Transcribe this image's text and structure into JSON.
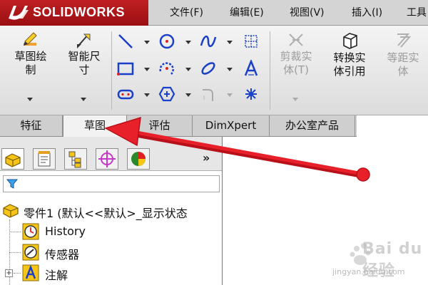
{
  "app": {
    "logo_text": "SOLIDWORKS"
  },
  "menu": [
    "文件(F)",
    "编辑(E)",
    "视图(V)",
    "插入(I)",
    "工具"
  ],
  "toolbar": {
    "sketch_button": [
      "草图绘",
      "制"
    ],
    "smart_dim_button": [
      "智能尺",
      "寸"
    ],
    "trim_button": [
      "剪裁实",
      "体(T)"
    ],
    "convert_button": [
      "转换实",
      "体引用"
    ],
    "offset_button": [
      "等距实",
      "体"
    ]
  },
  "tabs": [
    "特征",
    "草图",
    "评估",
    "DimXpert",
    "办公室产品"
  ],
  "active_tab": "草图",
  "panel": {
    "more_label": "»",
    "part_name": "零件1  (默认<<默认>_显示状态",
    "tree": [
      "History",
      "传感器",
      "注解"
    ],
    "expander": "+"
  },
  "watermark": {
    "text": "Bai du 经验",
    "url": "jingyan.baidu.com"
  },
  "colors": {
    "logo_red": "#b81a1d",
    "arrow_red": "#e8202a",
    "icon_blue": "#1a3fc9"
  }
}
